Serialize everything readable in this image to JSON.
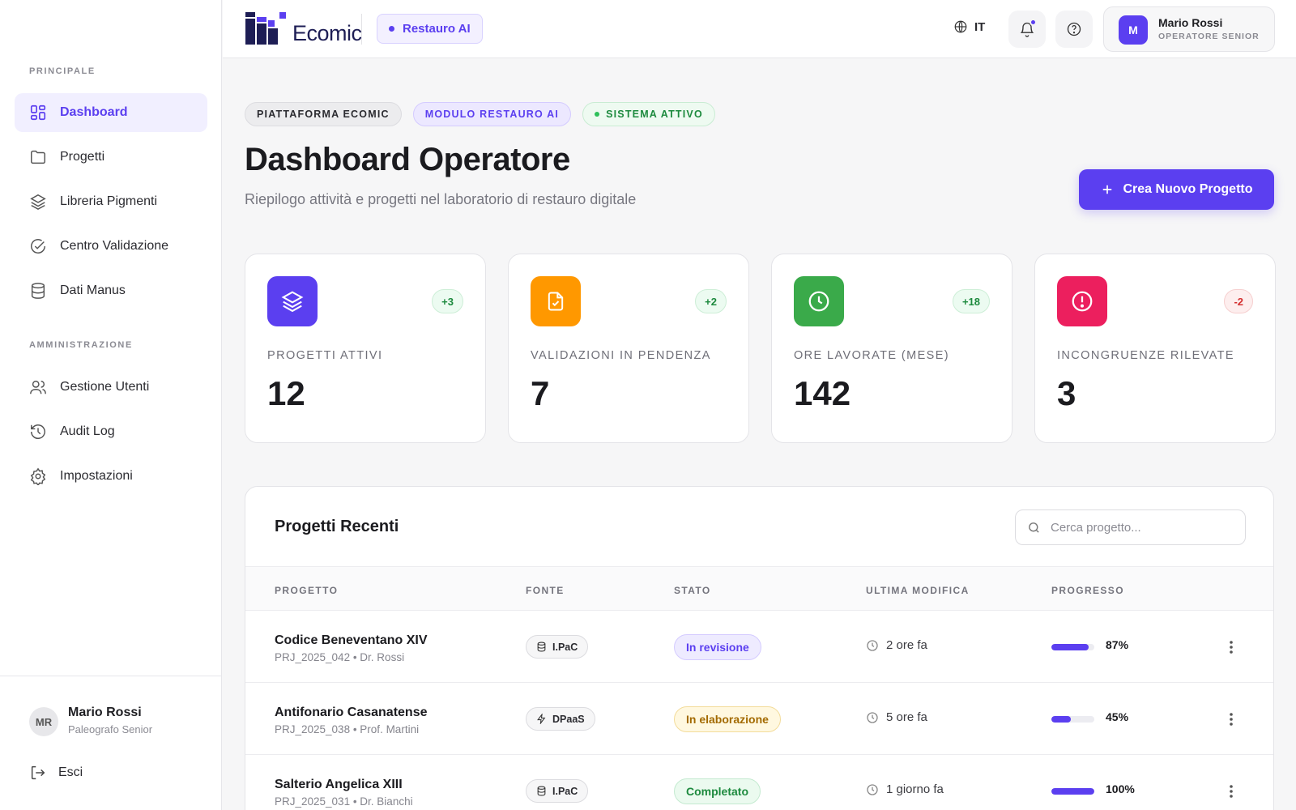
{
  "sidebar": {
    "section_main": "PRINCIPALE",
    "items_main": [
      {
        "label": "Dashboard",
        "icon": "grid-icon",
        "active": true
      },
      {
        "label": "Progetti",
        "icon": "folder-icon"
      },
      {
        "label": "Libreria Pigmenti",
        "icon": "layers-icon"
      },
      {
        "label": "Centro Validazione",
        "icon": "check-circle-icon"
      },
      {
        "label": "Dati Manus",
        "icon": "database-icon"
      }
    ],
    "section_admin": "AMMINISTRAZIONE",
    "items_admin": [
      {
        "label": "Gestione Utenti",
        "icon": "users-icon"
      },
      {
        "label": "Audit Log",
        "icon": "history-icon"
      },
      {
        "label": "Impostazioni",
        "icon": "gear-icon"
      }
    ],
    "user": {
      "initials": "MR",
      "name": "Mario Rossi",
      "role": "Paleografo Senior"
    },
    "logout_label": "Esci"
  },
  "header": {
    "logo_text": "Ecomic",
    "module_label": "Restauro AI",
    "language": "IT",
    "profile": {
      "initial": "M",
      "name": "Mario Rossi",
      "role": "OPERATORE SENIOR"
    }
  },
  "chips": [
    "PIATTAFORMA ECOMIC",
    "MODULO RESTAURO AI",
    "SISTEMA ATTIVO"
  ],
  "page": {
    "title": "Dashboard Operatore",
    "subtitle": "Riepilogo attività e progetti nel laboratorio di restauro digitale",
    "primary_button": "Crea Nuovo Progetto"
  },
  "stats": [
    {
      "label": "PROGETTI ATTIVI",
      "value": "12",
      "delta": "+3",
      "color": "#5b3ff0",
      "icon": "layers-icon"
    },
    {
      "label": "VALIDAZIONI IN PENDENZA",
      "value": "7",
      "delta": "+2",
      "color": "#ff9800",
      "icon": "file-check-icon"
    },
    {
      "label": "ORE LAVORATE (MESE)",
      "value": "142",
      "delta": "+18",
      "color": "#3aaa4a",
      "icon": "clock-icon"
    },
    {
      "label": "INCONGRUENZE RILEVATE",
      "value": "3",
      "delta": "-2",
      "color": "#ec1f5e",
      "icon": "alert-circle-icon"
    }
  ],
  "table": {
    "title": "Progetti Recenti",
    "search_placeholder": "Cerca progetto...",
    "columns": [
      "PROGETTO",
      "FONTE",
      "STATO",
      "ULTIMA MODIFICA",
      "PROGRESSO"
    ],
    "rows": [
      {
        "name": "Codice Beneventano XIV",
        "meta": "PRJ_2025_042 • Dr. Rossi",
        "source": "I.PaC",
        "source_icon": "database-icon",
        "status": "In revisione",
        "status_kind": "review",
        "modified": "2 ore fa",
        "progress": 87,
        "progress_label": "87%"
      },
      {
        "name": "Antifonario Casanatense",
        "meta": "PRJ_2025_038 • Prof. Martini",
        "source": "DPaaS",
        "source_icon": "bolt-icon",
        "status": "In elaborazione",
        "status_kind": "processing",
        "modified": "5 ore fa",
        "progress": 45,
        "progress_label": "45%"
      },
      {
        "name": "Salterio Angelica XIII",
        "meta": "PRJ_2025_031 • Dr. Bianchi",
        "source": "I.PaC",
        "source_icon": "database-icon",
        "status": "Completato",
        "status_kind": "done",
        "modified": "1 giorno fa",
        "progress": 100,
        "progress_label": "100%"
      }
    ]
  }
}
